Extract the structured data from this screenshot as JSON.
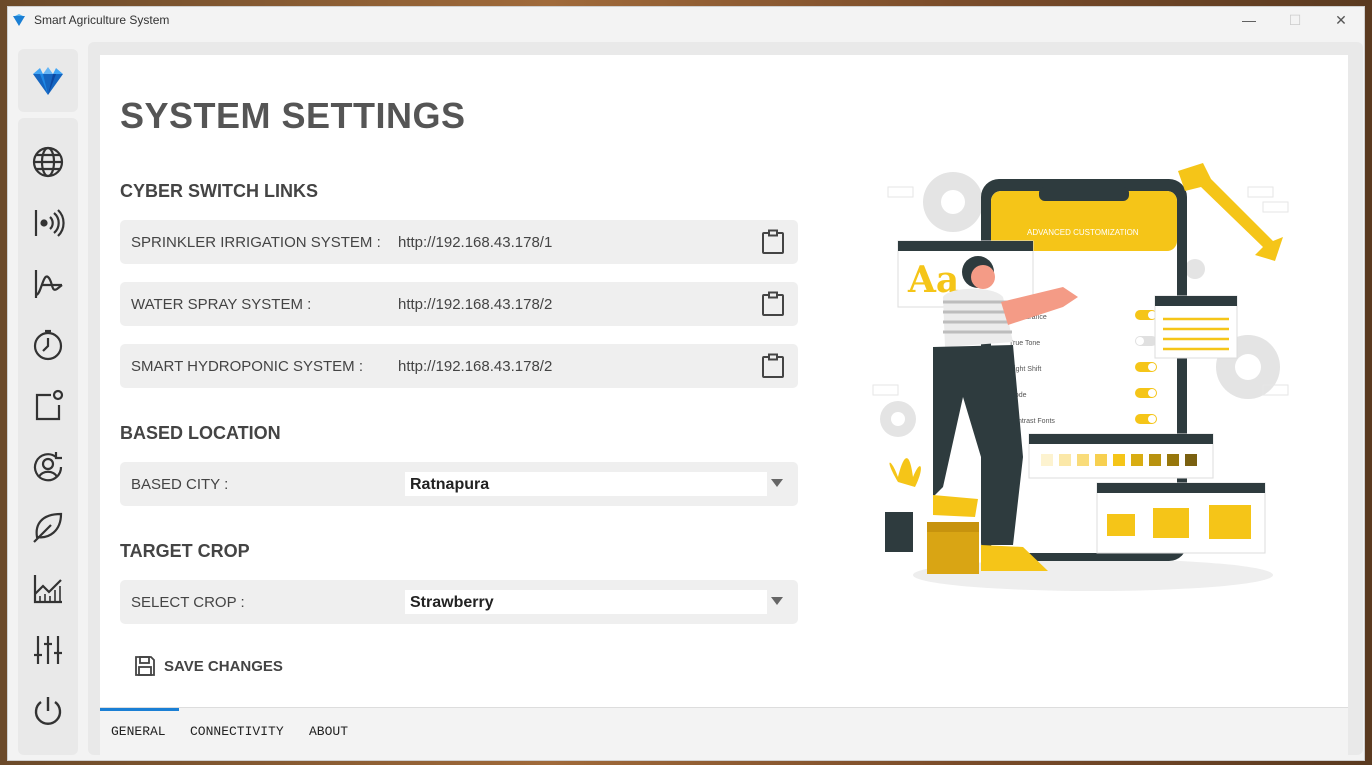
{
  "window": {
    "title": "Smart Agriculture System",
    "minimize": "—",
    "maximize": "☐",
    "close": "✕"
  },
  "sidebar": {
    "items": [
      {
        "icon": "globe-icon"
      },
      {
        "icon": "broadcast-icon"
      },
      {
        "icon": "chart-curve-icon"
      },
      {
        "icon": "clock-icon"
      },
      {
        "icon": "notification-box-icon"
      },
      {
        "icon": "user-sync-icon"
      },
      {
        "icon": "leaf-icon"
      },
      {
        "icon": "stats-icon"
      },
      {
        "icon": "sliders-icon"
      },
      {
        "icon": "power-icon"
      }
    ]
  },
  "main": {
    "page_title": "SYSTEM SETTINGS",
    "cyber_section": "CYBER SWITCH LINKS",
    "links": [
      {
        "label": "SPRINKLER IRRIGATION SYSTEM :",
        "value": "http://192.168.43.178/1"
      },
      {
        "label": "WATER SPRAY SYSTEM :",
        "value": "http://192.168.43.178/2"
      },
      {
        "label": "SMART HYDROPONIC SYSTEM :",
        "value": "http://192.168.43.178/2"
      }
    ],
    "location_section": "BASED LOCATION",
    "city_label": "BASED CITY :",
    "city_value": "Ratnapura",
    "crop_section": "TARGET CROP",
    "crop_label": "SELECT CROP :",
    "crop_value": "Strawberry",
    "save_label": "SAVE CHANGES"
  },
  "illustration": {
    "phone_header": "ADVANCED CUSTOMIZATION",
    "sample_text": "Aa",
    "settings": [
      "Appearance",
      "True Tone",
      "Night Shift",
      "Mode",
      "Contrast Fonts"
    ]
  },
  "tabs": [
    {
      "label": "GENERAL",
      "active": true
    },
    {
      "label": "CONNECTIVITY",
      "active": false
    },
    {
      "label": "ABOUT",
      "active": false
    }
  ],
  "colors": {
    "accent": "#1a7fd4",
    "illustration_yellow": "#f5c518",
    "illustration_dark": "#2e3b3e"
  }
}
